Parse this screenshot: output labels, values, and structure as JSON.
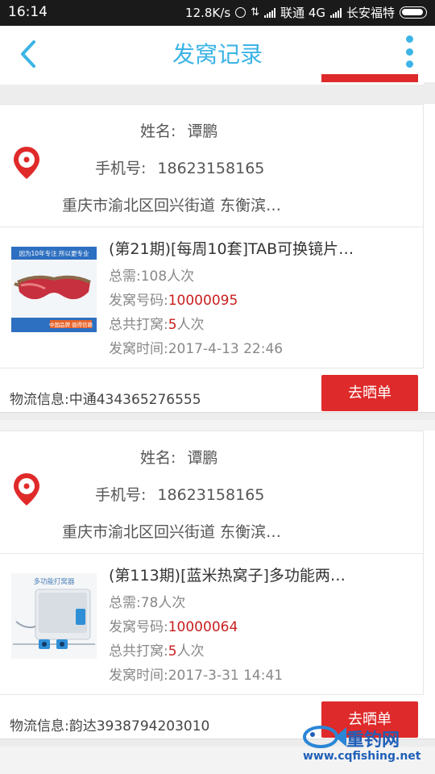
{
  "status_bar": {
    "time": "16:14",
    "speed": "12.8K/s",
    "carrier1": "联通 4G",
    "carrier2": "长安福特"
  },
  "header": {
    "title": "发窝记录"
  },
  "labels": {
    "name": "姓名:",
    "phone": "手机号:",
    "total_need": "总需:",
    "number": "发窝号码:",
    "total_times": "总共打窝:",
    "time": "发窝时间:",
    "shipping": "物流信息:",
    "show_button": "去晒单"
  },
  "records": [
    {
      "name": "谭鹏",
      "phone": "18623158165",
      "address": "重庆市渝北区回兴街道 东衡滨…",
      "product_title": "(第21期)[每周10套]TAB可换镜片…",
      "total_need": "108人次",
      "number": "10000095",
      "times_num": "5",
      "times_unit": "人次",
      "time": "2017-4-13 22:46",
      "shipping": "中通434365276555",
      "thumb_caption_top": "因为10年专注 所以更专业",
      "thumb_caption_bottom": "中国品牌 值得信赖"
    },
    {
      "name": "谭鹏",
      "phone": "18623158165",
      "address": "重庆市渝北区回兴街道 东衡滨…",
      "product_title": "(第113期)[蓝米热窝子]多功能两…",
      "total_need": "78人次",
      "number": "10000064",
      "times_num": "5",
      "times_unit": "人次",
      "time": "2017-3-31 14:41",
      "shipping": "韵达3938794203010",
      "thumb_caption_top": "多功能打窝器"
    }
  ],
  "watermark": {
    "brand": "重钓网",
    "url": "www.cqfishing.net"
  },
  "colors": {
    "accent": "#3cb4e6",
    "button": "#de2a2a",
    "highlight": "#c81e1e"
  }
}
